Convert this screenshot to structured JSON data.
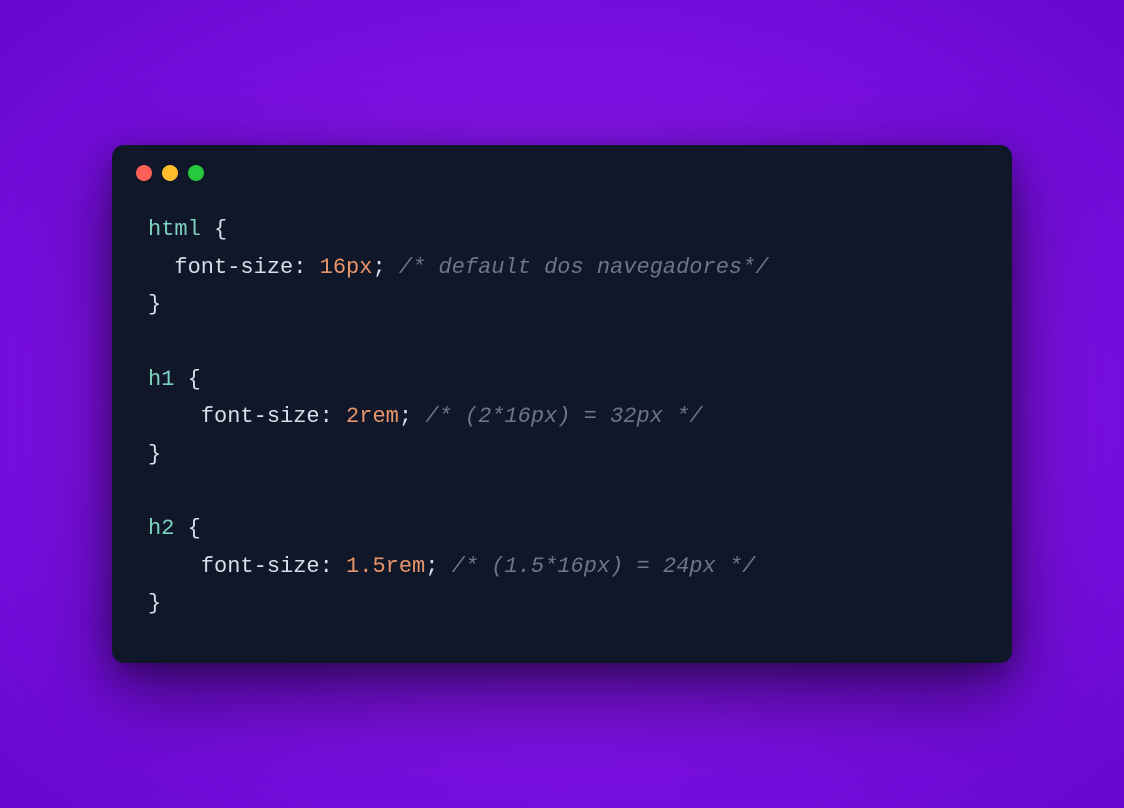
{
  "code": {
    "line1": {
      "selector": "html",
      "brace": " {"
    },
    "line2": {
      "indent": "  ",
      "property": "font-size",
      "colon": ": ",
      "value": "16px",
      "semi": "; ",
      "comment": "/* default dos navegadores*/"
    },
    "line3": {
      "brace": "}"
    },
    "line4": {
      "blank": ""
    },
    "line5": {
      "selector": "h1",
      "brace": " {"
    },
    "line6": {
      "indent": "    ",
      "property": "font-size",
      "colon": ": ",
      "value": "2rem",
      "semi": "; ",
      "comment": "/* (2*16px) = 32px */"
    },
    "line7": {
      "brace": "}"
    },
    "line8": {
      "blank": ""
    },
    "line9": {
      "selector": "h2",
      "brace": " {"
    },
    "line10": {
      "indent": "    ",
      "property": "font-size",
      "colon": ": ",
      "value": "1.5rem",
      "semi": "; ",
      "comment": "/* (1.5*16px) = 24px */"
    },
    "line11": {
      "brace": "}"
    }
  }
}
